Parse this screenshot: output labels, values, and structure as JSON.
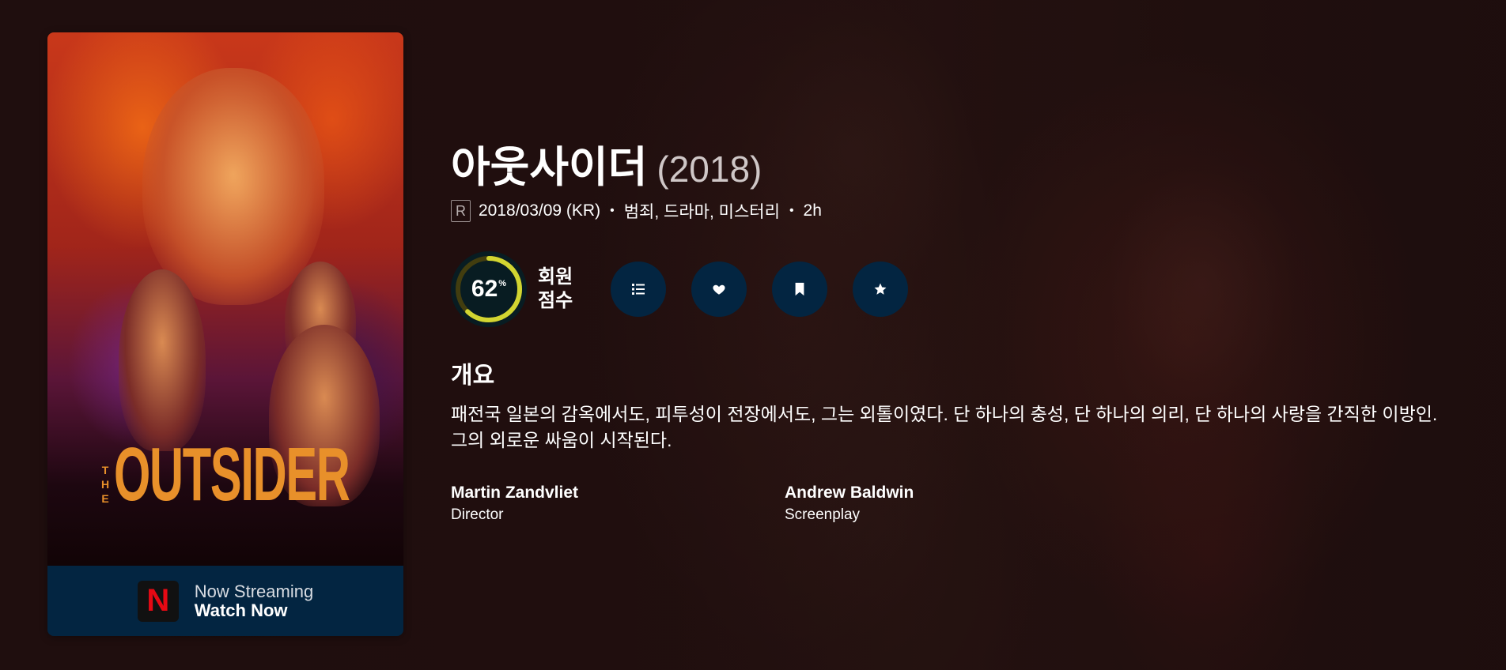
{
  "movie": {
    "title": "아웃사이더",
    "year": "(2018)",
    "certification": "R",
    "release": "2018/03/09 (KR)",
    "genres": "범죄, 드라마, 미스터리",
    "runtime": "2h",
    "poster_title_small": "THE",
    "poster_title_main": "OUTSIDER"
  },
  "score": {
    "value": "62",
    "unit": "%",
    "percent": 62,
    "label_line1": "회원",
    "label_line2": "점수",
    "ring_color": "#d2d531",
    "track_color": "#423d0f"
  },
  "actions": [
    {
      "icon": "list-icon"
    },
    {
      "icon": "heart-icon"
    },
    {
      "icon": "bookmark-icon"
    },
    {
      "icon": "star-icon"
    }
  ],
  "overview": {
    "heading": "개요",
    "text": "패전국 일본의 감옥에서도, 피투성이 전장에서도, 그는 외톨이였다. 단 하나의 충성, 단 하나의 의리, 단 하나의 사랑을 간직한 이방인. 그의 외로운 싸움이 시작된다."
  },
  "crew": [
    {
      "name": "Martin Zandvliet",
      "job": "Director"
    },
    {
      "name": "Andrew Baldwin",
      "job": "Screenplay"
    }
  ],
  "streaming": {
    "provider_letter": "N",
    "line1": "Now Streaming",
    "line2": "Watch Now"
  },
  "colors": {
    "accent_button": "#032541",
    "netflix_red": "#e50914"
  }
}
